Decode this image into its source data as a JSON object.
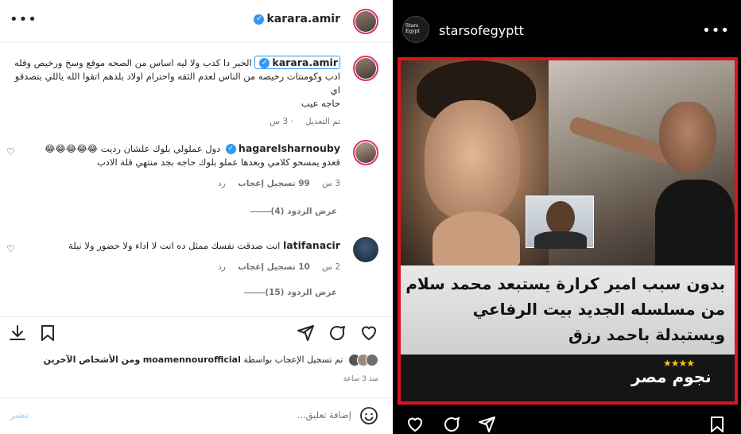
{
  "left": {
    "header": {
      "username": "karara.amir",
      "more_icon": "more-horizontal-icon"
    },
    "caption": {
      "username": "karara.amir",
      "lines": [
        "الخبر دا كدب ولا ليه اساس من الصحه موقع وسخ ورخيص وقله",
        "ادب وكومنتات رخيصه من الناس لعدم الثقه واحترام اولاد بلدهم اتقوا الله ياللي بتصدقو اي",
        "حاجه عيب"
      ],
      "edited": "تم التعديل",
      "time": "3 س"
    },
    "comments": [
      {
        "username": "hagarelsharnouby",
        "text_line1": "دول عملولي بلوك علشان رديت 😂😂😂😂😂",
        "text_line2": "قعدو يمسحو كلامي وبعدها عملو بلوك حاجه بجد منتهي قلة الادب",
        "time": "3 س",
        "likes": "99 تسجيل إعجاب",
        "reply": "رد",
        "view_replies": "عرض الردود (4)"
      },
      {
        "username": "latifanacir",
        "text_line1": "انت صدقت نفسك ممثل ده انت لا اداء ولا حضور ولا نيلة",
        "time": "2 س",
        "likes": "10 تسجيل إعجاب",
        "reply": "رد",
        "view_replies": "عرض الردود (15)"
      }
    ],
    "likes_line": {
      "prefix": "تم تسجيل الإعجاب بواسطة",
      "user": "moamennourofficial",
      "suffix": "ومن الأشخاص الآخرين"
    },
    "posted_time": "منذ 3 ساعة",
    "add_comment_placeholder": "إضافة تعليق...",
    "post_button": "نشر"
  },
  "right": {
    "username": "starsofegyptt",
    "avatar_text": "Stars Egypt",
    "headline": [
      "بدون سبب امير كرارة يستبعد محمد سلام",
      "من مسلسله الجديد بيت الرفاعي",
      "ويستبدلة باحمد رزق"
    ],
    "brand": "نجوم مصر",
    "stars": "★★★★"
  },
  "colors": {
    "accent": "#3797f0",
    "post_border": "#d6161d",
    "right_bg": "#000000"
  }
}
